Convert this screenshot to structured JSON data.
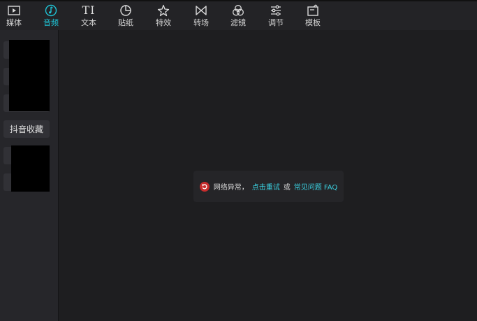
{
  "toolbar": {
    "items": [
      {
        "label": "媒体",
        "icon": "play-media-icon"
      },
      {
        "label": "音频",
        "icon": "music-note-icon"
      },
      {
        "label": "文本",
        "icon": "text-icon",
        "glyph": "TI"
      },
      {
        "label": "贴纸",
        "icon": "sticker-icon"
      },
      {
        "label": "特效",
        "icon": "sparkle-star-icon"
      },
      {
        "label": "转场",
        "icon": "bowtie-transition-icon"
      },
      {
        "label": "滤镜",
        "icon": "filter-circles-icon"
      },
      {
        "label": "调节",
        "icon": "sliders-icon"
      },
      {
        "label": "模板",
        "icon": "template-icon"
      }
    ],
    "active_index": 1,
    "active_color": "#1fc4d6"
  },
  "sidebar": {
    "favorite_tab": "抖音收藏"
  },
  "error_message": {
    "text": "网络异常，",
    "retry_link": "点击重试",
    "or": "或",
    "faq_link": "常见问题 FAQ",
    "icon": "refresh-error-icon",
    "link_color": "#3ad0e0"
  }
}
